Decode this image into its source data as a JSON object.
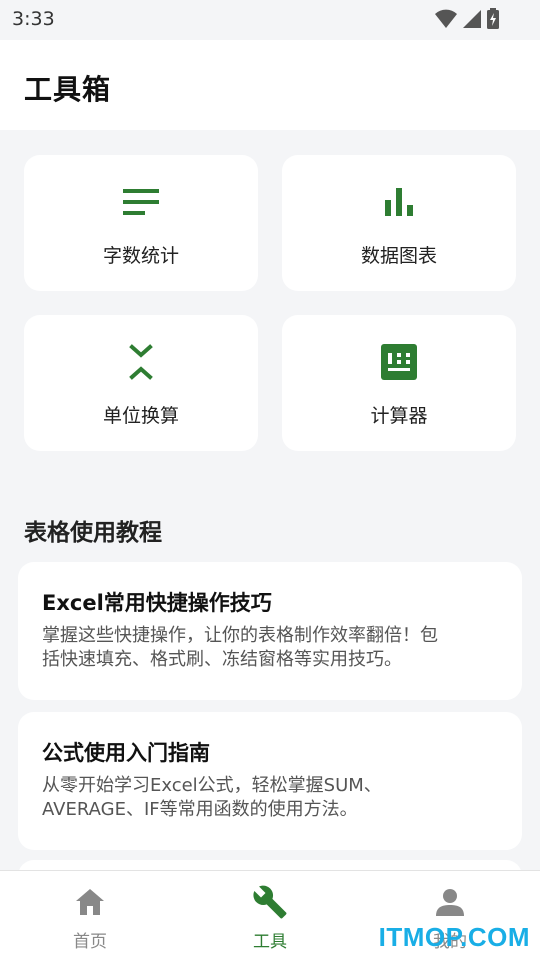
{
  "status_bar": {
    "time": "3:33"
  },
  "header": {
    "title": "工具箱"
  },
  "tools": [
    {
      "label": "字数统计",
      "icon": "text-lines-icon"
    },
    {
      "label": "数据图表",
      "icon": "bar-chart-icon"
    },
    {
      "label": "单位换算",
      "icon": "unfold-icon"
    },
    {
      "label": "计算器",
      "icon": "calculator-icon"
    }
  ],
  "section": {
    "title": "表格使用教程"
  },
  "tutorials": [
    {
      "title": "Excel常用快捷操作技巧",
      "desc_line1": "掌握这些快捷操作，让你的表格制作效率翻倍！包",
      "desc_line2": "括快速填充、格式刷、冻结窗格等实用技巧。"
    },
    {
      "title": "公式使用入门指南",
      "desc_line1": "从零开始学习Excel公式，轻松掌握SUM、",
      "desc_line2": "AVERAGE、IF等常用函数的使用方法。"
    }
  ],
  "bottom_nav": [
    {
      "label": "首页",
      "icon": "home-icon",
      "active": false
    },
    {
      "label": "工具",
      "icon": "wrench-icon",
      "active": true
    },
    {
      "label": "我的",
      "icon": "person-icon",
      "active": false
    }
  ],
  "watermark": "ITMOP.COM",
  "colors": {
    "accent": "#2e7d32",
    "background": "#f4f5f7",
    "card": "#ffffff",
    "inactive": "#888888",
    "watermark": "#19aee6"
  }
}
